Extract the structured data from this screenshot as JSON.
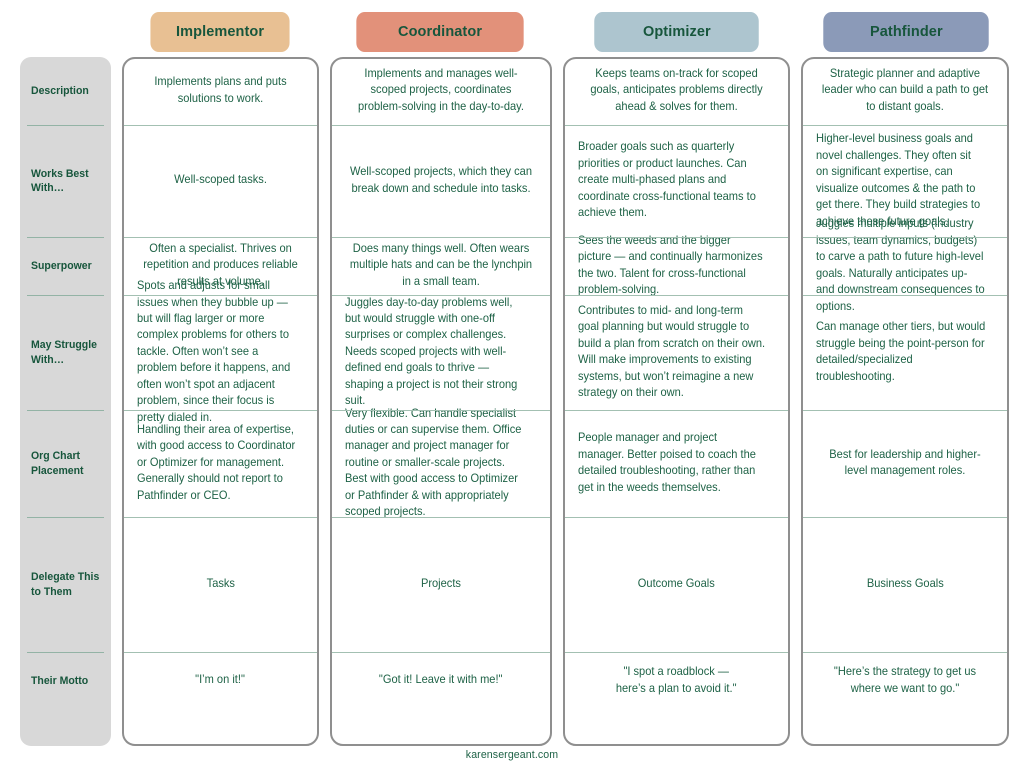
{
  "colors": {
    "implementor_pill": "#e8c093",
    "coordinator_pill": "#e2917a",
    "optimizer_pill": "#adc5cf",
    "pathfinder_pill": "#8b9ab8",
    "label_column_bg": "#d8d8d8",
    "text_green": "#1e6246",
    "heading_green": "#17563c",
    "card_border": "#8f8f8f",
    "row_divider": "#a3c0b2"
  },
  "columns": [
    {
      "id": "implementor",
      "label": "Implementor"
    },
    {
      "id": "coordinator",
      "label": "Coordinator"
    },
    {
      "id": "optimizer",
      "label": "Optimizer"
    },
    {
      "id": "pathfinder",
      "label": "Pathfinder"
    }
  ],
  "rows": [
    {
      "id": "description",
      "label": "Description",
      "cells": {
        "implementor": "Implements plans and puts solutions to work.",
        "coordinator": "Implements and manages well-scoped projects, coordinates problem-solving in the day-to-day.",
        "optimizer": "Keeps teams on-track for scoped goals, anticipates problems directly ahead & solves for them.",
        "pathfinder": "Strategic planner and adaptive leader who can build a path to get to distant goals."
      }
    },
    {
      "id": "works-best-with",
      "label": "Works Best With…",
      "cells": {
        "implementor": "Well-scoped tasks.",
        "coordinator": "Well-scoped projects, which they can break down and schedule into tasks.",
        "optimizer": "Broader goals such as quarterly priorities or product launches. Can create multi-phased plans and coordinate cross-functional teams to achieve them.",
        "pathfinder": "Higher-level business goals and novel challenges. They often sit on significant expertise, can visualize outcomes & the path to get there. They build strategies to achieve these future goals."
      }
    },
    {
      "id": "superpower",
      "label": "Superpower",
      "cells": {
        "implementor": "Often a specialist. Thrives on repetition and produces reliable results at volume.",
        "coordinator": "Does many things well. Often wears multiple hats and can be the lynchpin in a small team.",
        "optimizer": "Sees the weeds and the bigger picture — and continually harmonizes the two. Talent for cross-functional problem-solving.",
        "pathfinder": "Juggles multiple inputs (industry issues, team dynamics, budgets) to carve a path to future high-level goals. Naturally anticipates up- and downstream consequences to options."
      }
    },
    {
      "id": "may-struggle-with",
      "label": "May Struggle With…",
      "cells": {
        "implementor": "Spots and adjusts for small issues when they bubble up — but will flag larger or more complex problems for others to tackle. Often won’t see a problem before it happens, and often won’t spot an adjacent problem, since their focus is pretty dialed in.",
        "coordinator": "Juggles day-to-day problems well, but would struggle with one-off surprises or complex challenges. Needs scoped projects with well-defined end goals to thrive — shaping a project is not their strong suit.",
        "optimizer": "Contributes to mid- and long-term goal planning but would struggle to build a plan from scratch on their own. Will make improvements to existing systems, but won’t reimagine a new strategy on their own.",
        "pathfinder": "Can manage other tiers, but would struggle being the point-person for detailed/specialized troubleshooting."
      }
    },
    {
      "id": "org-chart-placement",
      "label": "Org Chart Placement",
      "cells": {
        "implementor": "Handling their area of expertise, with good access to Coordinator or Optimizer for management. Generally should not report to Pathfinder or CEO.",
        "coordinator": "Very flexible. Can handle specialist duties or can supervise them. Office manager and project manager for routine or smaller-scale projects. Best with good access to Optimizer or Pathfinder & with appropriately scoped projects.",
        "optimizer": "People manager and project manager. Better poised to coach the detailed troubleshooting, rather than get in the weeds themselves.",
        "pathfinder": "Best for leadership and higher-level management roles."
      }
    },
    {
      "id": "delegate-this-to-them",
      "label": "Delegate This to Them",
      "cells": {
        "implementor": "Tasks",
        "coordinator": "Projects",
        "optimizer": "Outcome Goals",
        "pathfinder": "Business Goals"
      }
    },
    {
      "id": "their-motto",
      "label": "Their Motto",
      "cells": {
        "implementor": "\"I’m on it!\"",
        "coordinator": "\"Got it! Leave it with me!\"",
        "optimizer": "\"I spot a roadblock —\nhere’s a plan to avoid it.\"",
        "pathfinder": "\"Here’s the strategy to get us where we want to go.\""
      }
    }
  ],
  "footer": {
    "credit": "karensergeant.com"
  }
}
